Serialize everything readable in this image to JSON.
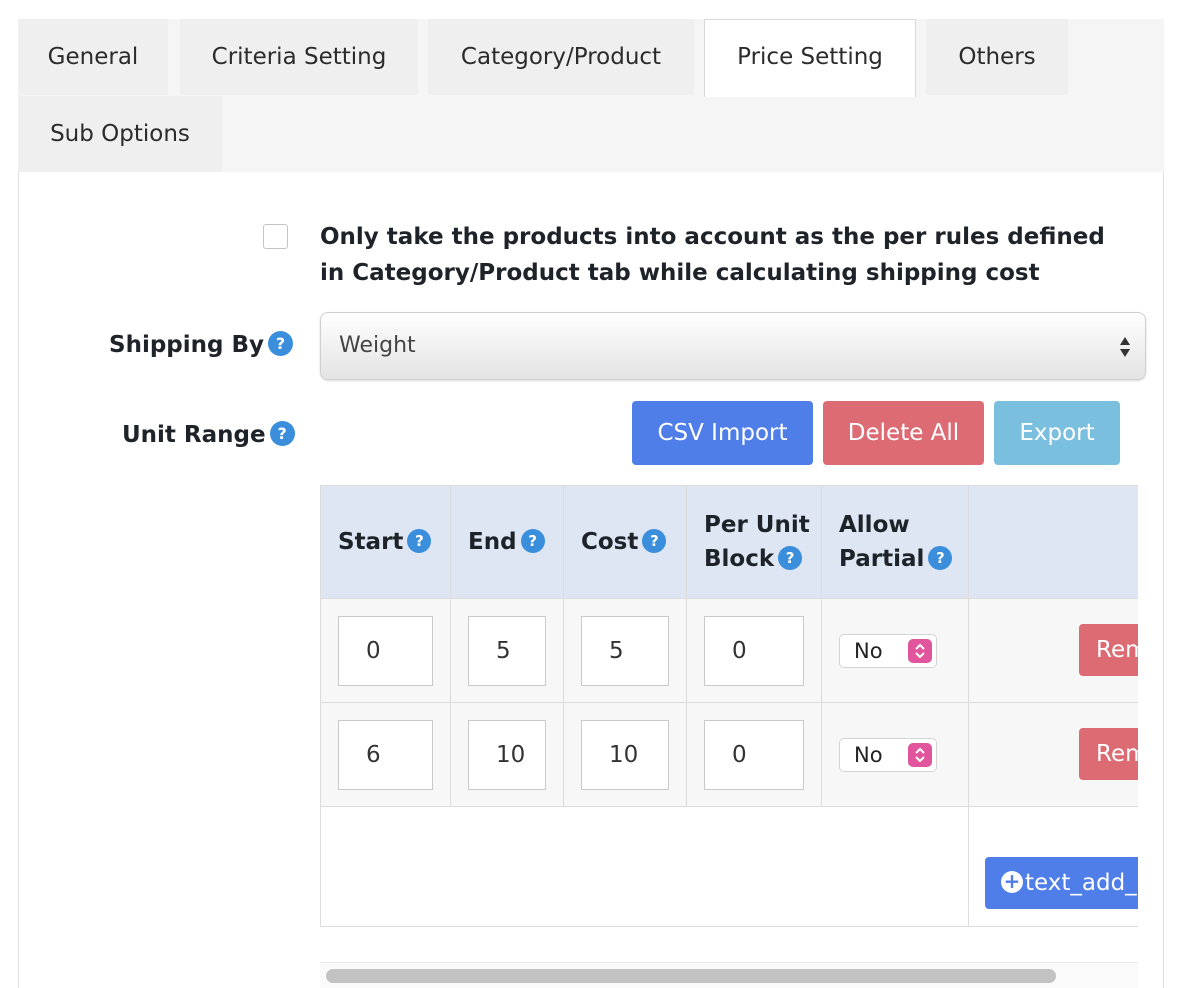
{
  "tabs": [
    {
      "label": "General"
    },
    {
      "label": "Criteria Setting"
    },
    {
      "label": "Category/Product"
    },
    {
      "label": "Price Setting",
      "active": true
    },
    {
      "label": "Others"
    },
    {
      "label": "Sub Options"
    }
  ],
  "products_rule": {
    "checked": false,
    "label": "Only take the products into account as the per rules defined in Category/Product tab while calculating shipping cost"
  },
  "shipping_by": {
    "label": "Shipping By",
    "help_icon": "?",
    "selected": "Weight"
  },
  "unit_range": {
    "label": "Unit Range",
    "help_icon": "?",
    "buttons": {
      "csv_import": "CSV Import",
      "delete_all": "Delete All",
      "export": "Export"
    },
    "headers": {
      "start": "Start",
      "end": "End",
      "cost": "Cost",
      "per_unit_block": "Per Unit Block",
      "allow_partial": "Allow Partial"
    },
    "rows": [
      {
        "start": "0",
        "end": "5",
        "cost": "5",
        "per_unit_block": "0",
        "allow_partial": "No",
        "remove_label": "Remove"
      },
      {
        "start": "6",
        "end": "10",
        "cost": "10",
        "per_unit_block": "0",
        "allow_partial": "No",
        "remove_label": "Remove"
      }
    ],
    "add_label": "text_add_new_range",
    "add_icon": "+"
  },
  "colors": {
    "primary": "#4f7ee9",
    "danger": "#dc6b74",
    "info": "#7bbfdf",
    "help": "#3a8edb",
    "select_accent": "#e0559c"
  }
}
